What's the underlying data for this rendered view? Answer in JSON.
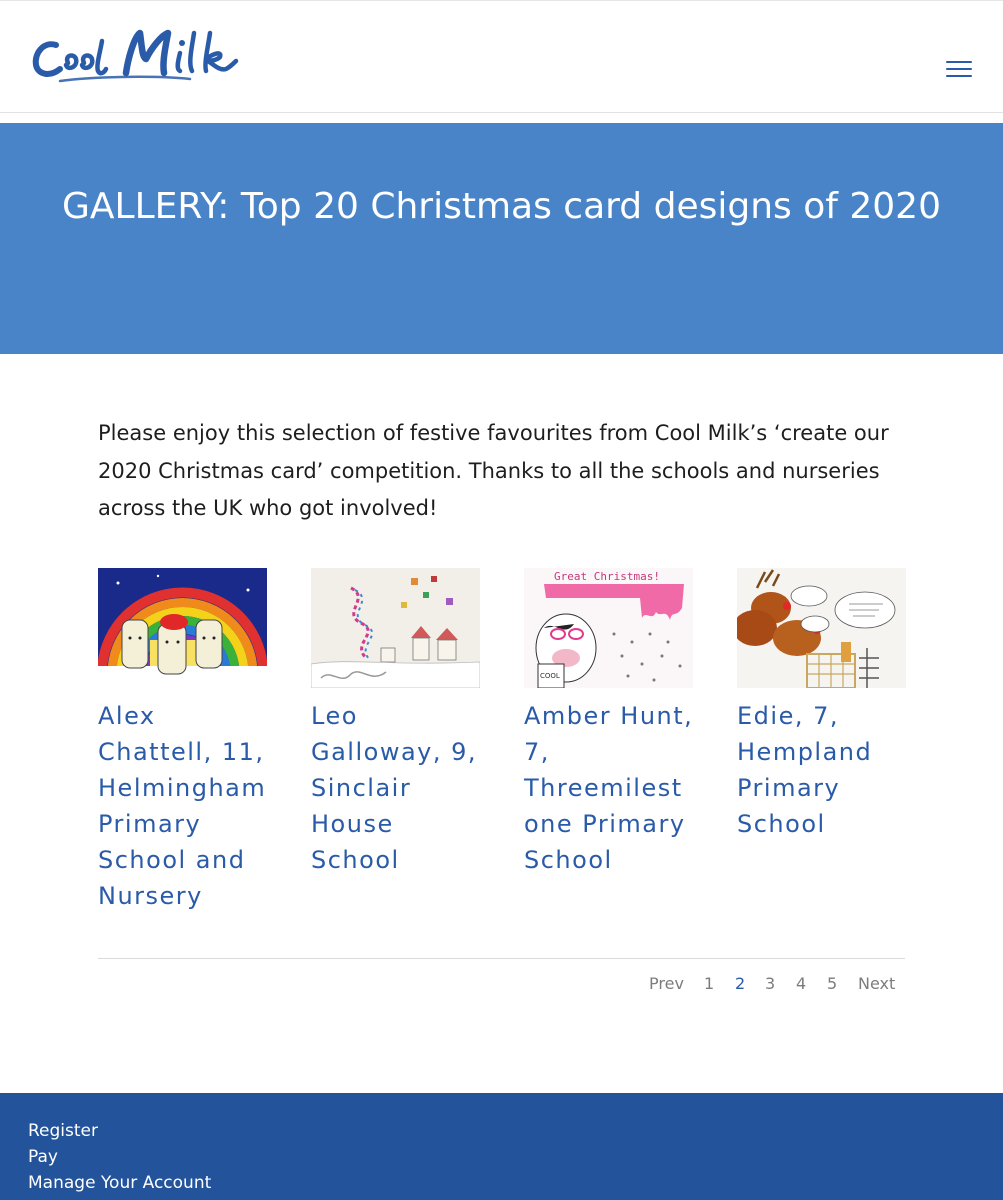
{
  "header": {
    "logo_text": "Cool Milk",
    "menu_icon": "hamburger-menu-icon"
  },
  "hero": {
    "title": "GALLERY: Top 20 Christmas card designs of 2020"
  },
  "intro": {
    "text": "Please enjoy this selection of festive favourites from Cool Milk’s ‘create our 2020 Christmas card’ competition.  Thanks to all the schools and nurseries across the UK who got involved!"
  },
  "gallery": {
    "items": [
      {
        "caption": "Alex Chattell, 11, Helmingham Primary School and Nursery",
        "image": "rainbow-milk-bottles-drawing"
      },
      {
        "caption": "Leo Galloway, 9, Sinclair House School",
        "image": "snowy-houses-presents-drawing"
      },
      {
        "caption": "Amber Hunt, 7, Threemilest one Primary School",
        "image": "cow-with-milk-carton-drawing"
      },
      {
        "caption": "Edie, 7, Hempland Primary School",
        "image": "reindeer-speech-bubbles-drawing"
      }
    ]
  },
  "pagination": {
    "prev": "Prev",
    "pages": [
      "1",
      "2",
      "3",
      "4",
      "5"
    ],
    "current": "2",
    "next": "Next"
  },
  "footer": {
    "links": [
      "Register",
      "Pay",
      "Manage Your Account"
    ]
  },
  "colors": {
    "brand_blue": "#2a5ba8",
    "hero_blue": "#4884c7",
    "footer_blue": "#23539a"
  }
}
